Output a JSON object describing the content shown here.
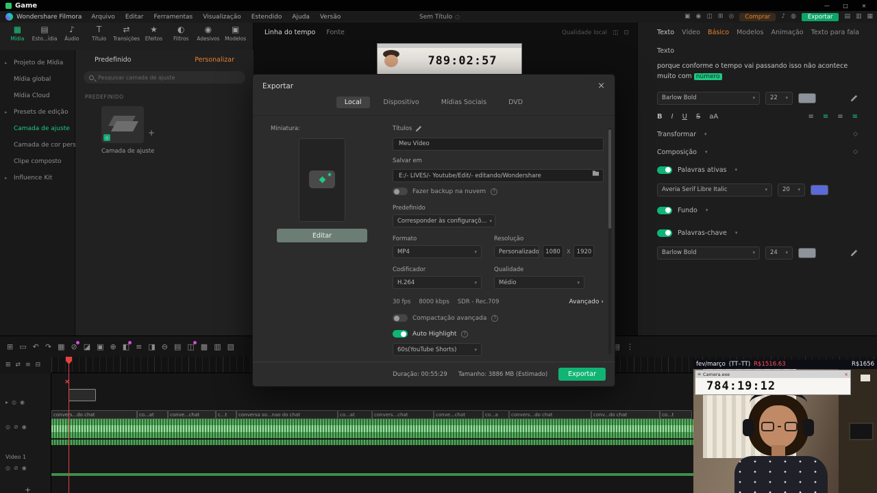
{
  "icons": {
    "dd": "▾",
    "tri": "▸",
    "rt": "›",
    "close": "×",
    "diamond": "◇",
    "plus": "+",
    "q": "?",
    "align": "≡",
    "dots": "⋮",
    "lock": "◎",
    "eye": "◉",
    "mute": "⊘",
    "clap": "◫",
    "proj": "◌"
  },
  "titlebar": {
    "title": "Game",
    "min": "—",
    "max": "□",
    "close": "×"
  },
  "menubar": {
    "brand": "Wondershare Filmora",
    "items": [
      "Arquivo",
      "Editar",
      "Ferramentas",
      "Visualização",
      "Estendido",
      "Ajuda",
      "Versão"
    ],
    "project": "Sem Título",
    "right_icons": [
      "▣",
      "◉",
      "◫",
      "⊞",
      "◎"
    ],
    "buy": "Comprar",
    "mid_icons": [
      "♪",
      "◍"
    ],
    "export": "Exportar",
    "layout_icons": [
      "▤",
      "▥",
      "▦"
    ]
  },
  "toolbar": {
    "items": [
      {
        "icon": "▦",
        "label": "Mídia"
      },
      {
        "icon": "▤",
        "label": "Esto...ídia"
      },
      {
        "icon": "♪",
        "label": "Áudio"
      },
      {
        "icon": "T",
        "label": "Título"
      },
      {
        "icon": "⇄",
        "label": "Transições"
      },
      {
        "icon": "★",
        "label": "Efeitos"
      },
      {
        "icon": "◐",
        "label": "Filtros"
      },
      {
        "icon": "◉",
        "label": "Adesivos"
      },
      {
        "icon": "▣",
        "label": "Modelos"
      }
    ]
  },
  "sidebar": {
    "items": [
      {
        "label": "Projeto de Mídia"
      },
      {
        "label": "Mídia global"
      },
      {
        "label": "Mídia Cloud"
      },
      {
        "label": "Presets de edição"
      },
      {
        "label": "Camada de ajuste"
      },
      {
        "label": "Camada de cor perso..."
      },
      {
        "label": "Clipe composto"
      },
      {
        "label": "Influence Kit"
      }
    ]
  },
  "media_panel": {
    "tab_predefined": "Predefinido",
    "tab_customize": "Personalizar",
    "search_placeholder": "Pesquisar camada de ajuste",
    "section": "PREDEFINIDO",
    "item_caption": "Camada de ajuste"
  },
  "preview": {
    "tab_timeline": "Linha do tempo",
    "tab_source": "Fonte",
    "quality": "Qualidade local",
    "timer": "789:02:57"
  },
  "dialog": {
    "title": "Exportar",
    "tabs": [
      "Local",
      "Dispositivo",
      "Mídias Sociais",
      "DVD"
    ],
    "thumb_label": "Miniatura:",
    "edit_btn": "Editar",
    "titles_label": "Títulos",
    "title_value": "Meu Vídeo",
    "save_label": "Salvar em",
    "path_value": "E:/- LIVES/- Youtube/Edit/- editando/Wondershare",
    "backup_label": "Fazer backup na nuvem",
    "preset_label": "Predefinido",
    "preset_value": "Corresponder às configuraçõ...",
    "format_label": "Formato",
    "format_value": "MP4",
    "resolution_label": "Resolução",
    "resolution_value": "Personalizado",
    "res_w": "1080",
    "res_x": "X",
    "res_h": "1920",
    "encoder_label": "Codificador",
    "encoder_value": "H.264",
    "quality_label": "Qualidade",
    "quality_value": "Médio",
    "fps": "30 fps",
    "bitrate": "8000 kbps",
    "colorspace": "SDR - Rec.709",
    "advanced": "Avançado",
    "compression_label": "Compactação avançada",
    "highlight_label": "Auto Highlight",
    "length_value": "60s(YouTube Shorts)",
    "duration": "Duração: 00:55:29",
    "size": "Tamanho: 3886 MB (Estimado)",
    "export_btn": "Exportar"
  },
  "right_panel": {
    "tabs": [
      "Texto",
      "Vídeo",
      "Básico",
      "Modelos",
      "Animação",
      "Texto para fala"
    ],
    "section_texto": "Texto",
    "caption": "porque conforme o tempo vai passando isso não acontece muito com",
    "caption_highlight": "número",
    "font1_name": "Barlow Bold",
    "font1_size": "22",
    "fmt": [
      "B",
      "I",
      "U",
      "S",
      "aA"
    ],
    "transform": "Transformar",
    "composition": "Composição",
    "active_words": "Palavras ativas",
    "font2_name": "Averia Serif Libre Italic",
    "font2_size": "20",
    "fundo": "Fundo",
    "keywords": "Palavras-chave",
    "font3_name": "Barlow Bold",
    "font3_size": "24"
  },
  "timeline": {
    "tool_icons": [
      "⊞",
      "▭",
      "↶",
      "↷",
      "▦",
      "⊘",
      "◪",
      "▣",
      "⊕",
      "◧",
      "≡",
      "◨",
      "⊖",
      "▤",
      "◫",
      "▩",
      "▥",
      "▧"
    ],
    "right_icons": [
      "▤",
      "⋮"
    ],
    "row2_icons": [
      "⊞",
      "⇄",
      "≡",
      "⊟"
    ],
    "track1_label": "Video 1",
    "clips": [
      {
        "label": "convers...do chat"
      },
      {
        "label": "co...at"
      },
      {
        "label": "conve...chat"
      },
      {
        "label": "c...t"
      },
      {
        "label": "conversa so...nao do chat"
      },
      {
        "label": "co...at"
      },
      {
        "label": "convers...chat"
      },
      {
        "label": "conve...chat"
      },
      {
        "label": "co...a"
      },
      {
        "label": "convers...do chat"
      },
      {
        "label": "conv...do chat"
      },
      {
        "label": "co...t"
      }
    ]
  },
  "webcam": {
    "month": "fev/março",
    "emote": "(TT–TT)",
    "amount": "R$1516.63",
    "total": "R$1656",
    "window_title": "Camera.exe",
    "timer": "784:19:12"
  }
}
